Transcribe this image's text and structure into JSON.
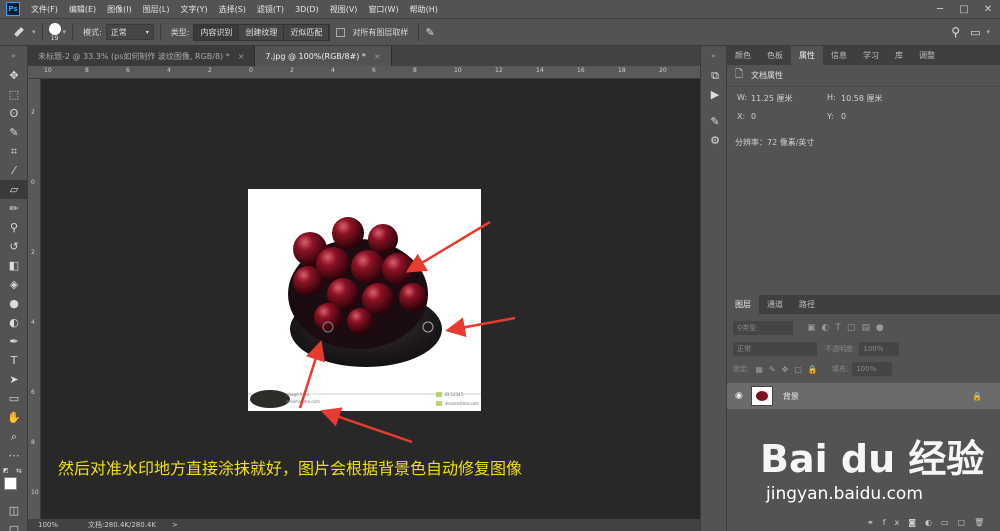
{
  "app": {
    "logo": "Ps"
  },
  "menu": [
    "文件(F)",
    "编辑(E)",
    "图像(I)",
    "图层(L)",
    "文字(Y)",
    "选择(S)",
    "滤镜(T)",
    "3D(D)",
    "视图(V)",
    "窗口(W)",
    "帮助(H)"
  ],
  "window_controls": [
    "─",
    "□",
    "✕"
  ],
  "options_bar": {
    "brush_size": "19",
    "mode_label": "模式:",
    "mode_value": "正常",
    "type_label": "类型:",
    "type_options": [
      "内容识别",
      "创建纹理",
      "近似匹配"
    ],
    "sample_all_label": "对所有图层取样"
  },
  "tabs": [
    {
      "label": "未标题-2 @ 33.3% (ps如何制作 波纹图像, RGB/8) *",
      "close": "×"
    },
    {
      "label": "7.jpg @ 100%(RGB/8#) *",
      "close": "×"
    }
  ],
  "ruler_h": [
    "10",
    "8",
    "6",
    "4",
    "2",
    "0",
    "2",
    "4",
    "6",
    "8",
    "10",
    "12",
    "14",
    "16",
    "18",
    "20"
  ],
  "ruler_v": [
    "2",
    "0",
    "2",
    "4",
    "6",
    "8",
    "10"
  ],
  "status": {
    "zoom": "100%",
    "doc": "文档:280.4K/280.4K",
    "arrow": ">"
  },
  "caption": "然后对准水印地方直接涂抹就好，图片会根据背景色自动修复图像",
  "image_watermark": {
    "left": "Image from",
    "left2": "dreamstime.com",
    "right1": "ID 12345",
    "right2": "dreamstime.com"
  },
  "properties_panel": {
    "tabs": [
      "颜色",
      "色板",
      "属性",
      "信息",
      "学习",
      "库",
      "调整"
    ],
    "active_tab": "属性",
    "title": "文档属性",
    "w_label": "W:",
    "w_value": "11.25 厘米",
    "h_label": "H:",
    "h_value": "10.58 厘米",
    "x_label": "X:",
    "x_value": "0",
    "y_label": "Y:",
    "y_value": "0",
    "resolution": "分辨率：72 像素/英寸"
  },
  "layers_panel": {
    "tabs": [
      "图层",
      "通道",
      "路径"
    ],
    "filter_label": "类型",
    "blend_mode": "正常",
    "opacity_label": "不透明度:",
    "opacity_value": "100%",
    "lock_label": "锁定:",
    "fill_label": "填充:",
    "fill_value": "100%",
    "layer_name": "背景"
  },
  "watermark": {
    "brand": "Bai du 经验",
    "url": "jingyan.baidu.com"
  },
  "colors": {
    "caption": "#f0e010",
    "arrow": "#e63b2e",
    "canvas": "#282828",
    "ui": "#535353"
  }
}
